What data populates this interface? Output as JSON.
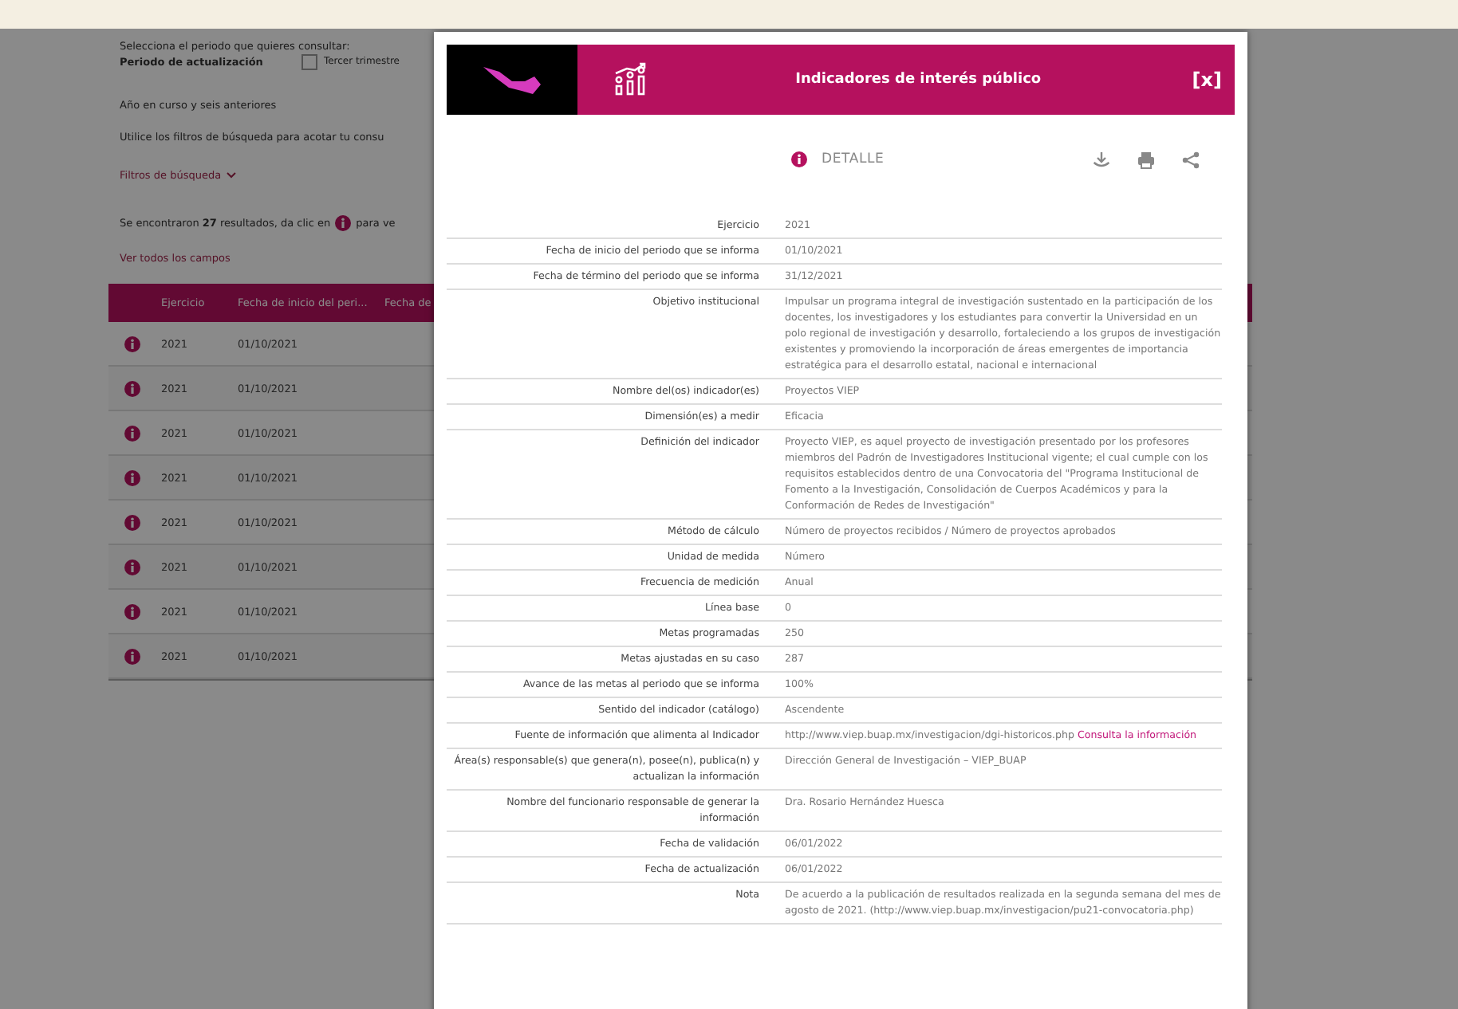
{
  "page": {
    "prompt": "Selecciona el periodo que quieres consultar:",
    "period_label": "Periodo de actualización",
    "period_options": [
      {
        "label": "Tercer trimestre",
        "checked": false
      }
    ],
    "range_note": "Año en curso y seis anteriores",
    "filter_hint": "Utilice los filtros de búsqueda para acotar tu consu",
    "filters_toggle": "Filtros de búsqueda",
    "results_text": "Se encontraron **27** resultados, da clic en",
    "results_tail": "para ve",
    "view_all": "Ver todos los campos"
  },
  "table": {
    "columns": [
      "Ejercicio",
      "Fecha de inicio del peri...",
      "Fecha de"
    ],
    "rows": [
      {
        "cells": [
          "2021",
          "01/10/2021"
        ]
      },
      {
        "cells": [
          "2021",
          "01/10/2021"
        ]
      },
      {
        "cells": [
          "2021",
          "01/10/2021"
        ]
      },
      {
        "cells": [
          "2021",
          "01/10/2021"
        ]
      },
      {
        "cells": [
          "2021",
          "01/10/2021"
        ]
      },
      {
        "cells": [
          "2021",
          "01/10/2021"
        ]
      },
      {
        "cells": [
          "2021",
          "01/10/2021"
        ]
      },
      {
        "cells": [
          "2021",
          "01/10/2021"
        ]
      }
    ]
  },
  "modal": {
    "title": "Indicadores de interés público",
    "close": "[x]",
    "detail_label": "DETALLE",
    "fields": [
      {
        "label": "Ejercicio",
        "value": "2021"
      },
      {
        "label": "Fecha de inicio del periodo que se informa",
        "value": "01/10/2021"
      },
      {
        "label": "Fecha de término del periodo que se informa",
        "value": "31/12/2021"
      },
      {
        "label": "Objetivo institucional",
        "value": "Impulsar un programa integral de investigación sustentado en la participación de los docentes, los investigadores y los estudiantes para convertir la Universidad en un polo regional de investigación y desarrollo, fortaleciendo a los grupos de investigación existentes y promoviendo la incorporación de áreas emergentes de importancia estratégica para el desarrollo estatal, nacional e internacional"
      },
      {
        "label": "Nombre del(os) indicador(es)",
        "value": "Proyectos VIEP"
      },
      {
        "label": "Dimensión(es) a medir",
        "value": "Eficacia"
      },
      {
        "label": "Definición del indicador",
        "value": "Proyecto VIEP, es aquel proyecto de investigación presentado por los profesores miembros del Padrón de Investigadores Institucional vigente; el cual cumple con los requisitos establecidos dentro de una Convocatoria del \"Programa Institucional de Fomento a la Investigación, Consolidación de Cuerpos Académicos y para la Conformación de Redes de Investigación\""
      },
      {
        "label": "Método de cálculo",
        "value": "Número de proyectos recibidos / Número de proyectos aprobados"
      },
      {
        "label": "Unidad de medida",
        "value": "Número"
      },
      {
        "label": "Frecuencia de medición",
        "value": "Anual"
      },
      {
        "label": "Línea base",
        "value": "0"
      },
      {
        "label": "Metas programadas",
        "value": "250"
      },
      {
        "label": "Metas ajustadas en su caso",
        "value": "287"
      },
      {
        "label": "Avance de las metas al periodo que se informa",
        "value": "100%"
      },
      {
        "label": "Sentido del indicador (catálogo)",
        "value": "Ascendente"
      },
      {
        "label": "Fuente de información que alimenta al Indicador",
        "value": "http://www.viep.buap.mx/investigacion/dgi-historicos.php",
        "link": "Consulta la información"
      },
      {
        "label": "Área(s) responsable(s) que genera(n), posee(n), publica(n) y actualizan la información",
        "value": "Dirección General de Investigación – VIEP_BUAP"
      },
      {
        "label": "Nombre del funcionario responsable de generar la información",
        "value": "Dra. Rosario Hernández Huesca"
      },
      {
        "label": "Fecha de validación",
        "value": "06/01/2022"
      },
      {
        "label": "Fecha de actualización",
        "value": "06/01/2022"
      },
      {
        "label": "Nota",
        "value": "De acuerdo a la publicación de resultados realizada en la segunda semana del mes de agosto de 2021. (http://www.viep.buap.mx/investigacion/pu21-convocatoria.php)"
      }
    ]
  }
}
